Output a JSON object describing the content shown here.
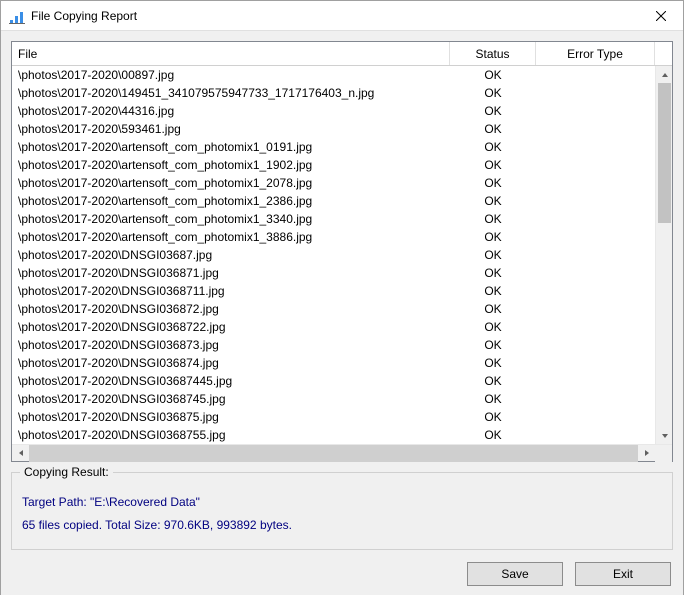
{
  "window": {
    "title": "File Copying Report"
  },
  "table": {
    "columns": {
      "file": "File",
      "status": "Status",
      "error_type": "Error Type"
    },
    "rows": [
      {
        "file": "\\photos\\2017-2020\\00897.jpg",
        "status": "OK",
        "error": ""
      },
      {
        "file": "\\photos\\2017-2020\\149451_341079575947733_1717176403_n.jpg",
        "status": "OK",
        "error": ""
      },
      {
        "file": "\\photos\\2017-2020\\44316.jpg",
        "status": "OK",
        "error": ""
      },
      {
        "file": "\\photos\\2017-2020\\593461.jpg",
        "status": "OK",
        "error": ""
      },
      {
        "file": "\\photos\\2017-2020\\artensoft_com_photomix1_0191.jpg",
        "status": "OK",
        "error": ""
      },
      {
        "file": "\\photos\\2017-2020\\artensoft_com_photomix1_1902.jpg",
        "status": "OK",
        "error": ""
      },
      {
        "file": "\\photos\\2017-2020\\artensoft_com_photomix1_2078.jpg",
        "status": "OK",
        "error": ""
      },
      {
        "file": "\\photos\\2017-2020\\artensoft_com_photomix1_2386.jpg",
        "status": "OK",
        "error": ""
      },
      {
        "file": "\\photos\\2017-2020\\artensoft_com_photomix1_3340.jpg",
        "status": "OK",
        "error": ""
      },
      {
        "file": "\\photos\\2017-2020\\artensoft_com_photomix1_3886.jpg",
        "status": "OK",
        "error": ""
      },
      {
        "file": "\\photos\\2017-2020\\DNSGI03687.jpg",
        "status": "OK",
        "error": ""
      },
      {
        "file": "\\photos\\2017-2020\\DNSGI036871.jpg",
        "status": "OK",
        "error": ""
      },
      {
        "file": "\\photos\\2017-2020\\DNSGI0368711.jpg",
        "status": "OK",
        "error": ""
      },
      {
        "file": "\\photos\\2017-2020\\DNSGI036872.jpg",
        "status": "OK",
        "error": ""
      },
      {
        "file": "\\photos\\2017-2020\\DNSGI0368722.jpg",
        "status": "OK",
        "error": ""
      },
      {
        "file": "\\photos\\2017-2020\\DNSGI036873.jpg",
        "status": "OK",
        "error": ""
      },
      {
        "file": "\\photos\\2017-2020\\DNSGI036874.jpg",
        "status": "OK",
        "error": ""
      },
      {
        "file": "\\photos\\2017-2020\\DNSGI03687445.jpg",
        "status": "OK",
        "error": ""
      },
      {
        "file": "\\photos\\2017-2020\\DNSGI0368745.jpg",
        "status": "OK",
        "error": ""
      },
      {
        "file": "\\photos\\2017-2020\\DNSGI036875.jpg",
        "status": "OK",
        "error": ""
      },
      {
        "file": "\\photos\\2017-2020\\DNSGI0368755.jpg",
        "status": "OK",
        "error": ""
      }
    ]
  },
  "result": {
    "legend": "Copying Result:",
    "target_path": "Target Path: \"E:\\Recovered Data\"",
    "summary": "65 files copied. Total Size: 970.6KB, 993892 bytes."
  },
  "buttons": {
    "save": "Save",
    "exit": "Exit"
  }
}
